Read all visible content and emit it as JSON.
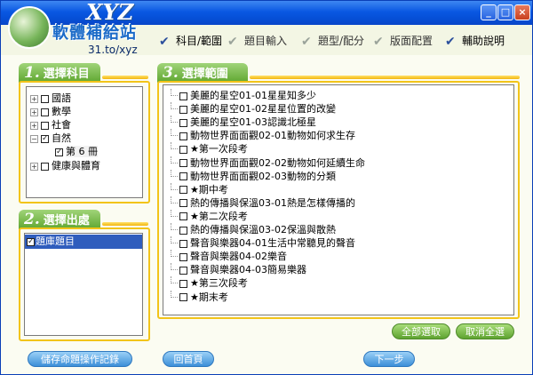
{
  "logo": {
    "text_top": "XYZ",
    "brand": "軟體補給站",
    "url": "31.to/xyz"
  },
  "window_buttons": {
    "minimize": "_",
    "maximize": "□",
    "close": "×"
  },
  "steps": [
    {
      "label": "科目/範圍",
      "state": "current"
    },
    {
      "label": "題目輸入",
      "state": "done"
    },
    {
      "label": "題型/配分",
      "state": "done"
    },
    {
      "label": "版面配置",
      "state": "done"
    },
    {
      "label": "輔助說明",
      "state": "current"
    }
  ],
  "panel1": {
    "number": "1.",
    "title": "選擇科目",
    "tree": [
      {
        "label": "國語",
        "expander": "+",
        "checked": false
      },
      {
        "label": "數學",
        "expander": "+",
        "checked": false
      },
      {
        "label": "社會",
        "expander": "+",
        "checked": false
      },
      {
        "label": "自然",
        "expander": "−",
        "checked": true
      },
      {
        "label": "第 6 冊",
        "expander": "",
        "checked": true,
        "child": true
      },
      {
        "label": "健康與體育",
        "expander": "+",
        "checked": false
      }
    ]
  },
  "panel2": {
    "number": "2.",
    "title": "選擇出處",
    "items": [
      {
        "label": "題庫題目",
        "checked": true,
        "selected": true
      }
    ]
  },
  "panel3": {
    "number": "3.",
    "title": "選擇範圍",
    "items": [
      "美麗的星空01-01星星知多少",
      "美麗的星空01-02星星位置的改變",
      "美麗的星空01-03認識北極星",
      "動物世界面面觀02-01動物如何求生存",
      "★第一次段考",
      "動物世界面面觀02-02動物如何延續生命",
      "動物世界面面觀02-03動物的分類",
      "★期中考",
      "熱的傳播與保溫03-01熱是怎樣傳播的",
      "★第二次段考",
      "熱的傳播與保溫03-02保溫與散熱",
      "聲音與樂器04-01生活中常聽見的聲音",
      "聲音與樂器04-02樂音",
      "聲音與樂器04-03簡易樂器",
      "★第三次段考",
      "★期末考"
    ],
    "select_all": "全部選取",
    "deselect_all": "取消全選"
  },
  "footer": {
    "save_log": "儲存命題操作記錄",
    "home": "回首頁",
    "next": "下一步"
  }
}
